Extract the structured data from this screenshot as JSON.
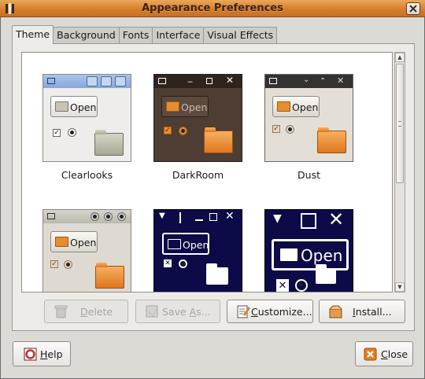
{
  "window": {
    "title": "Appearance Preferences"
  },
  "tabs": [
    "Theme",
    "Background",
    "Fonts",
    "Interface",
    "Visual Effects"
  ],
  "themes": [
    "Clearlooks",
    "DarkRoom",
    "Dust",
    "",
    "",
    ""
  ],
  "preview": {
    "open_label": "Open"
  },
  "buttons": {
    "delete": {
      "pre": "",
      "u": "D",
      "post": "elete"
    },
    "save_as": {
      "pre": "Save ",
      "u": "A",
      "post": "s..."
    },
    "customize": {
      "pre": "",
      "u": "C",
      "post": "ustomize..."
    },
    "install": {
      "pre": "",
      "u": "I",
      "post": "nstall..."
    },
    "help": {
      "pre": "",
      "u": "H",
      "post": "elp"
    },
    "close": {
      "pre": "",
      "u": "C",
      "post": "lose"
    }
  },
  "colors": {
    "titlebar": "#d77e2d",
    "folder_orange": "#e88d2d",
    "navy": "#0c0a47",
    "darkroom": "#4d3d33"
  }
}
